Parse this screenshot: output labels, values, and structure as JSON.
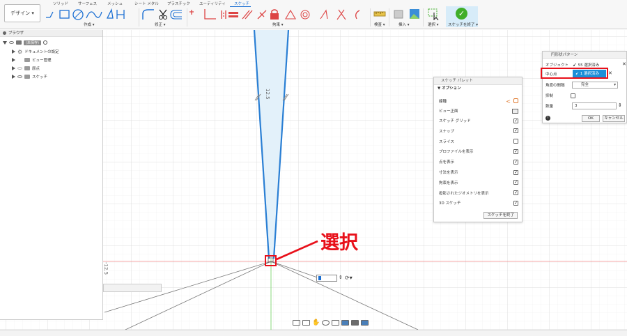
{
  "workspace": {
    "label": "デザイン ▾"
  },
  "tabs": [
    {
      "label": "ソリッド",
      "active": false
    },
    {
      "label": "サーフェス",
      "active": false
    },
    {
      "label": "メッシュ",
      "active": false
    },
    {
      "label": "シート メタル",
      "active": false
    },
    {
      "label": "プラスチック",
      "active": false
    },
    {
      "label": "ユーティリティ",
      "active": false
    },
    {
      "label": "スケッチ",
      "active": true
    }
  ],
  "groups": {
    "create": "作成 ▾",
    "modify": "修正 ▾",
    "constraints": "拘束 ▾",
    "inspect": "検査 ▾",
    "insert": "挿入 ▾",
    "select": "選択 ▾",
    "finish": "スケッチを終了 ▾"
  },
  "browser": {
    "title": "ブラウザ",
    "root": "(未保存)",
    "items": [
      "ドキュメントの設定",
      "ビュー管理",
      "原点",
      "スケッチ"
    ]
  },
  "palette": {
    "title": "スケッチ パレット",
    "section": "▼ オプション",
    "rows": [
      {
        "label": "線種",
        "checked": null
      },
      {
        "label": "ビュー正面",
        "checked": null
      },
      {
        "label": "スケッチ グリッド",
        "checked": true
      },
      {
        "label": "スナップ",
        "checked": true
      },
      {
        "label": "スライス",
        "checked": false
      },
      {
        "label": "プロファイルを表示",
        "checked": true
      },
      {
        "label": "点を表示",
        "checked": true
      },
      {
        "label": "寸法を表示",
        "checked": true
      },
      {
        "label": "拘束を表示",
        "checked": true
      },
      {
        "label": "投影されたジオメトリを表示",
        "checked": true
      },
      {
        "label": "3D スケッチ",
        "checked": true
      }
    ],
    "finish_button": "スケッチを終了"
  },
  "dialog": {
    "title": "円形状パターン",
    "objects_label": "オブジェクト",
    "objects_value": "55 選択済み",
    "center_label": "中心点",
    "center_value": "1 選択済み",
    "distribution_label": "角度の間隔",
    "distribution_value": "完全",
    "suppress_label": "抑制",
    "quantity_label": "数量",
    "quantity_value": "3",
    "ok_label": "OK",
    "cancel_label": "キャンセル",
    "close_mark": "✕",
    "info_mark": "i"
  },
  "annotation": {
    "text": "選択"
  },
  "dimensions": {
    "vertical": "12.5",
    "axis": "-12.5"
  },
  "colors": {
    "accent": "#1b6fd3",
    "selected": "#1b8fd8",
    "highlight": "#e8101a",
    "finish_bg": "#d7ecf9",
    "check_green": "#3fae29",
    "profile_fill": "#e3f1fa",
    "sketch_line": "#2a7fd4"
  }
}
